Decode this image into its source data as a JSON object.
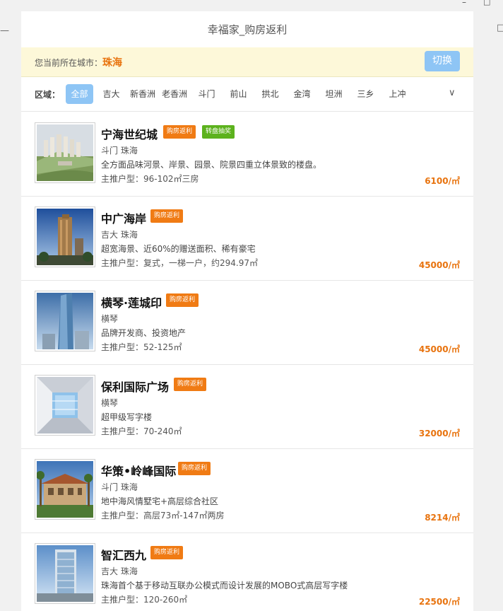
{
  "window": {
    "minimize_glyph": "–",
    "maximize_glyph": "□",
    "left_edge_glyph": "—",
    "right_edge_glyph": "□"
  },
  "page_title": "幸福家_购房返利",
  "city_bar": {
    "label": "您当前所在城市：",
    "city": "珠海",
    "switch_label": "切换"
  },
  "district_filter": {
    "label": "区域：",
    "items": [
      "全部",
      "吉大",
      "新香洲",
      "老香洲",
      "斗门",
      "前山",
      "拱北",
      "金湾",
      "坦洲",
      "三乡",
      "上冲"
    ],
    "active_index": 0,
    "expand_icon": "chevron-down-icon",
    "expand_glyph": "∨"
  },
  "listings": [
    {
      "name": "宁海世纪城",
      "badges": [
        {
          "text": "购房返利",
          "color": "#f07b14"
        },
        {
          "text": "转盘抽奖",
          "color": "#5cb21d"
        }
      ],
      "location": "斗门 珠海",
      "description": "全方面品味河景、岸景、园景、院景四重立体景致的楼盘。",
      "main_layout": "主推户型：96-102㎡三房",
      "price": "6100/㎡"
    },
    {
      "name": "中广海岸",
      "badges": [
        {
          "text": "购房返利",
          "color": "#f07b14"
        }
      ],
      "location": "吉大 珠海",
      "description": "超宽海景、近60%的赠送面积、稀有豪宅",
      "main_layout": "主推户型：复式，一梯一户，约294.97㎡",
      "price": "45000/㎡"
    },
    {
      "name": "横琴·莲城印",
      "badges": [
        {
          "text": "购房返利",
          "color": "#f07b14"
        }
      ],
      "location": "横琴",
      "description": "品牌开发商、投资地产",
      "main_layout": "主推户型：52-125㎡",
      "price": "45000/㎡"
    },
    {
      "name": "保利国际广场",
      "badges": [
        {
          "text": "购房返利",
          "color": "#f07b14"
        }
      ],
      "location": "横琴",
      "description": "超甲级写字楼",
      "main_layout": "主推户型：70-240㎡",
      "price": "32000/㎡"
    },
    {
      "name": "华策•岭峰国际",
      "badges": [
        {
          "text": "购房返利",
          "color": "#f07b14"
        }
      ],
      "location": "斗门 珠海",
      "description": "地中海风情墅宅+高层综合社区",
      "main_layout": "主推户型：高层73㎡-147㎡两房",
      "price": "8214/㎡"
    },
    {
      "name": "智汇西九",
      "badges": [
        {
          "text": "购房返利",
          "color": "#f07b14"
        }
      ],
      "location": "吉大 珠海",
      "description": "珠海首个基于移动互联办公模式而设计发展的MOBO式高层写字楼",
      "main_layout": "主推户型：120-260㎡",
      "price": "22500/㎡"
    }
  ]
}
